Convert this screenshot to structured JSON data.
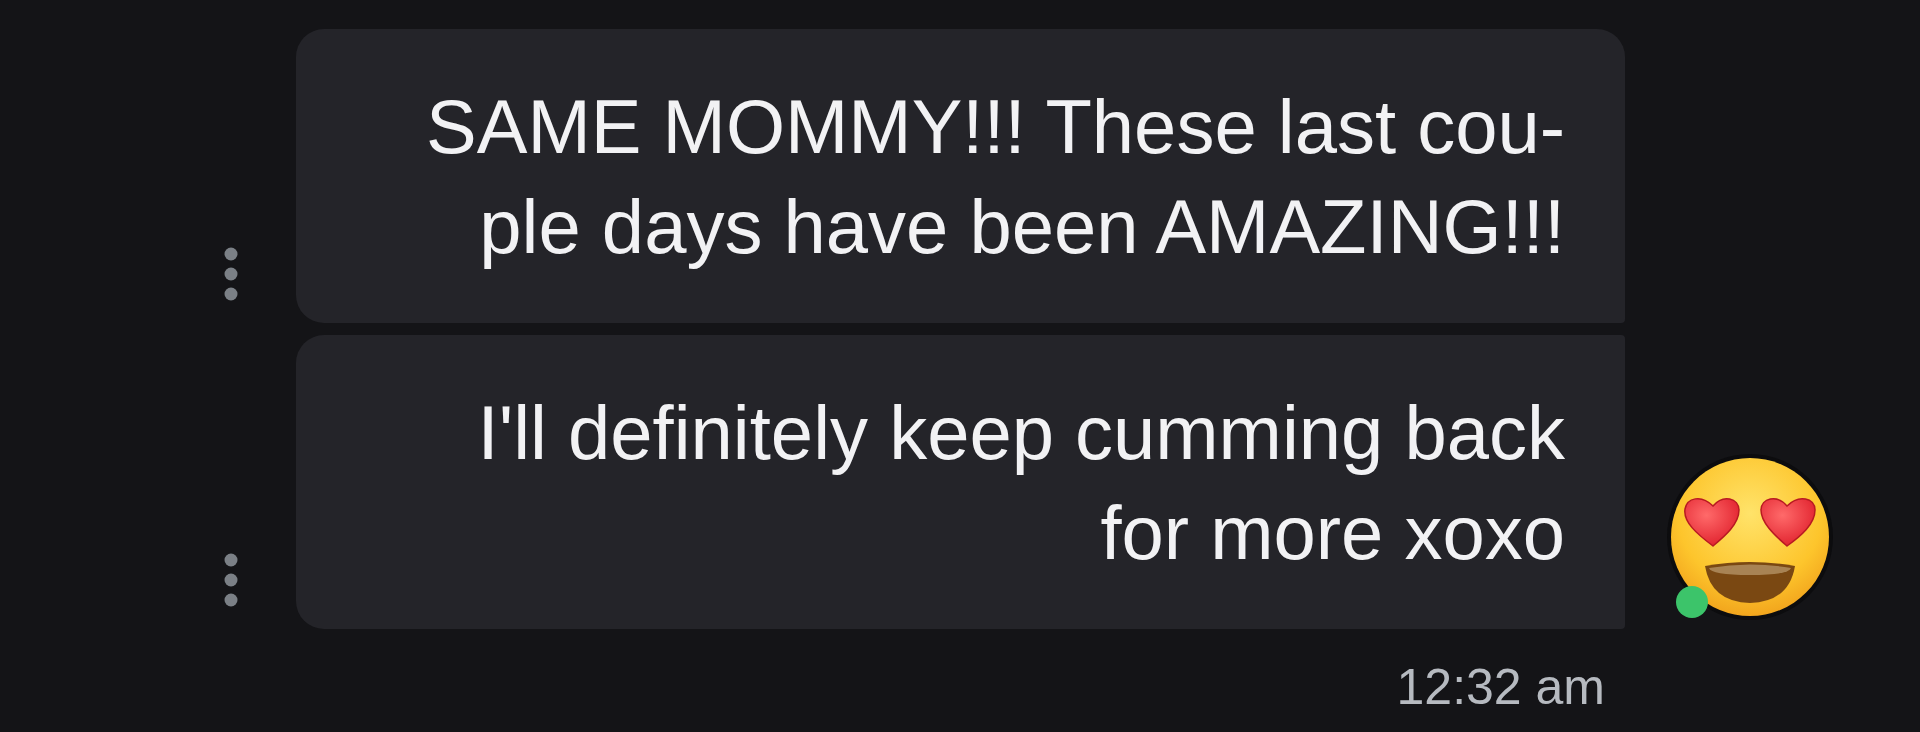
{
  "messages": [
    {
      "text": "SAME MOMMY!!! These last cou-\nple days have been AMAZING!!!"
    },
    {
      "text": "I'll definitely keep cumming back\nfor more xoxo"
    }
  ],
  "avatar": {
    "online": true
  },
  "timestamp": "12:32 am"
}
